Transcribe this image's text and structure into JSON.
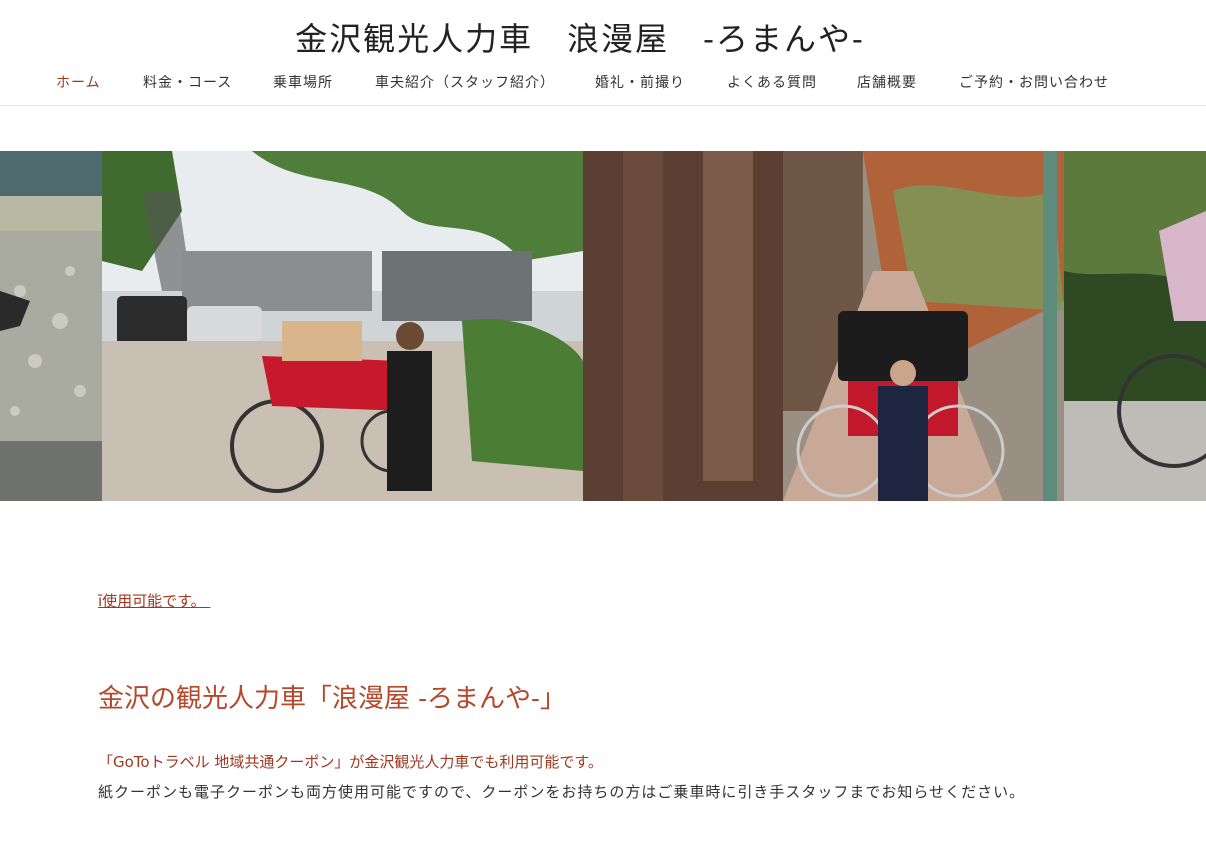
{
  "header": {
    "site_title": "金沢観光人力車　浪漫屋　-ろまんや-",
    "nav": [
      {
        "label": "ホーム",
        "active": true
      },
      {
        "label": "料金・コース"
      },
      {
        "label": "乗車場所"
      },
      {
        "label": "車夫紹介（スタッフ紹介）"
      },
      {
        "label": "婚礼・前撮り"
      },
      {
        "label": "よくある質問"
      },
      {
        "label": "店舗概要"
      },
      {
        "label": "ご予約・お問い合わせ"
      }
    ]
  },
  "slider": {
    "slides": [
      {
        "name": "riverside-rickshaw-photo"
      },
      {
        "name": "station-rickshaw-photo"
      },
      {
        "name": "chaya-street-rickshaw-photo"
      },
      {
        "name": "garden-rickshaw-photo"
      }
    ],
    "dots": 2,
    "active_dot": 0
  },
  "main": {
    "coupon_link": "ī使用可能です。 ",
    "heading": "金沢の観光人力車「浪漫屋 -ろまんや-」",
    "lead": "「GoToトラベル 地域共通クーポン」が金沢観光人力車でも利用可能です。",
    "body": "紙クーポンも電子クーポンも両方使用可能ですので、クーポンをお持ちの方はご乗車時に引き手スタッフまでお知らせください。"
  },
  "colors": {
    "accent": "#a0381f",
    "heading": "#b5472b",
    "text": "#333333"
  }
}
